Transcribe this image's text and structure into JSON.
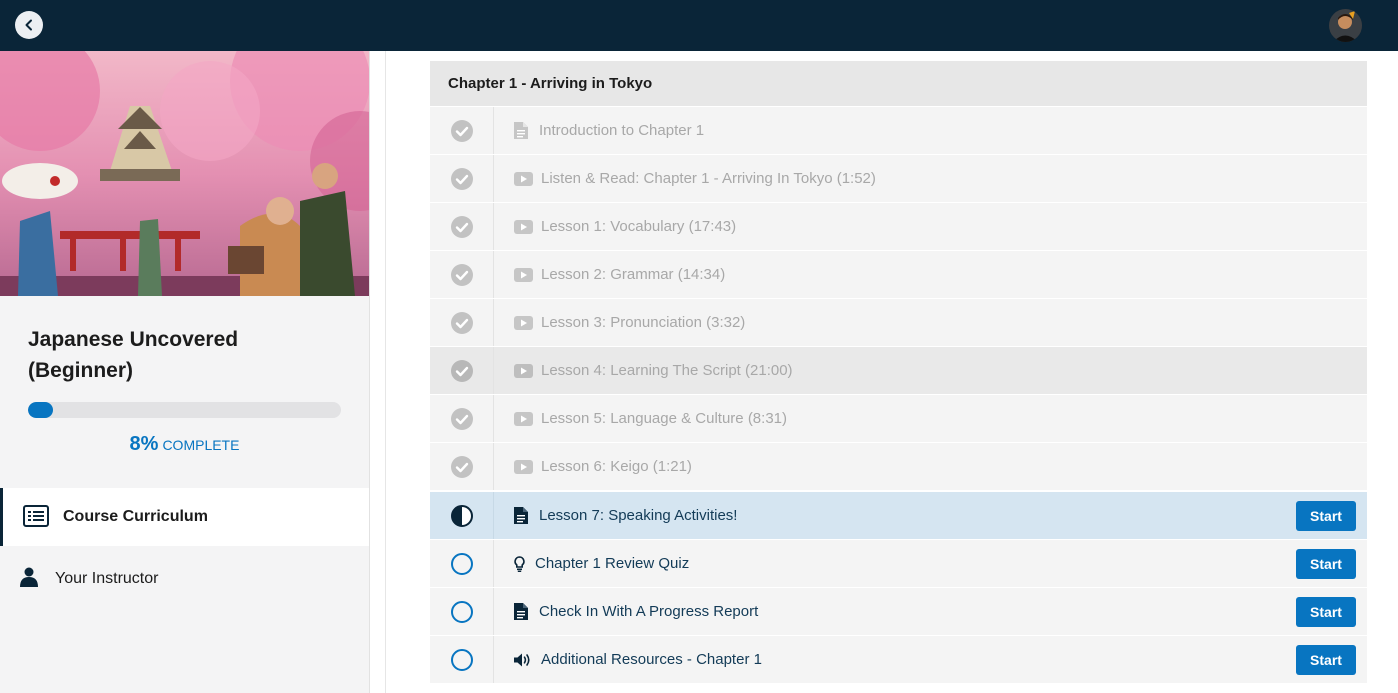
{
  "topbar": {
    "back_icon": "chevron-left-icon",
    "avatar": "user-avatar"
  },
  "sidebar": {
    "course_title": "Japanese Uncovered (Beginner)",
    "progress": {
      "percent": 8,
      "percent_label": "8%",
      "complete_label": "COMPLETE"
    },
    "nav": [
      {
        "label": "Course Curriculum",
        "icon": "list-icon",
        "active": true
      },
      {
        "label": "Your Instructor",
        "icon": "user-icon",
        "active": false
      }
    ]
  },
  "main": {
    "chapter_title": "Chapter 1 - Arriving in Tokyo",
    "lectures": [
      {
        "title": "Introduction to Chapter 1",
        "type": "document",
        "status": "completed"
      },
      {
        "title": "Listen & Read: Chapter 1 - Arriving In Tokyo (1:52)",
        "type": "video",
        "status": "completed"
      },
      {
        "title": "Lesson 1: Vocabulary (17:43)",
        "type": "video",
        "status": "completed"
      },
      {
        "title": "Lesson 2: Grammar (14:34)",
        "type": "video",
        "status": "completed"
      },
      {
        "title": "Lesson 3: Pronunciation (3:32)",
        "type": "video",
        "status": "completed"
      },
      {
        "title": "Lesson 4: Learning The Script (21:00)",
        "type": "video",
        "status": "completed"
      },
      {
        "title": "Lesson 5: Language & Culture (8:31)",
        "type": "video",
        "status": "completed"
      },
      {
        "title": "Lesson 6: Keigo (1:21)",
        "type": "video",
        "status": "completed"
      },
      {
        "title": "Lesson 7: Speaking Activities!",
        "type": "document",
        "status": "in-progress",
        "button": "Start"
      },
      {
        "title": "Chapter 1 Review Quiz",
        "type": "quiz",
        "status": "not-started",
        "button": "Start"
      },
      {
        "title": "Check In With A Progress Report",
        "type": "document",
        "status": "not-started",
        "button": "Start"
      },
      {
        "title": "Additional Resources - Chapter 1",
        "type": "audio",
        "status": "not-started",
        "button": "Start"
      }
    ]
  },
  "colors": {
    "topbar": "#0a2538",
    "accent": "#0875c1",
    "completed_text": "#a8a8a8",
    "todo_text": "#133b57",
    "current_row": "#d5e5f1"
  }
}
